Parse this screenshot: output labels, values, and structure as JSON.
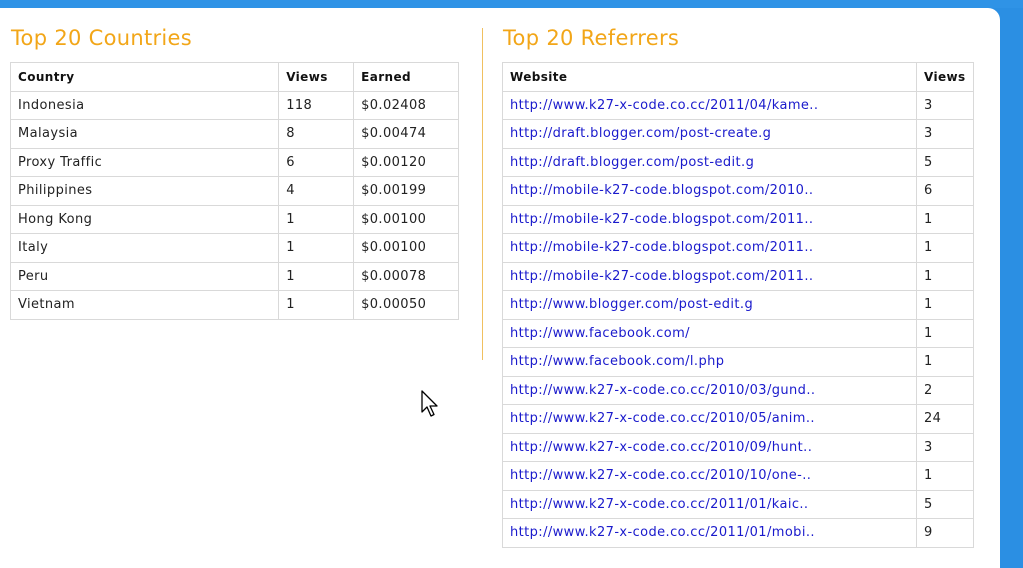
{
  "countries": {
    "title": "Top 20 Countries",
    "headers": {
      "country": "Country",
      "views": "Views",
      "earned": "Earned"
    },
    "rows": [
      {
        "country": "Indonesia",
        "views": "118",
        "earned": "$0.02408"
      },
      {
        "country": "Malaysia",
        "views": "8",
        "earned": "$0.00474"
      },
      {
        "country": "Proxy Traffic",
        "views": "6",
        "earned": "$0.00120"
      },
      {
        "country": "Philippines",
        "views": "4",
        "earned": "$0.00199"
      },
      {
        "country": "Hong Kong",
        "views": "1",
        "earned": "$0.00100"
      },
      {
        "country": "Italy",
        "views": "1",
        "earned": "$0.00100"
      },
      {
        "country": "Peru",
        "views": "1",
        "earned": "$0.00078"
      },
      {
        "country": "Vietnam",
        "views": "1",
        "earned": "$0.00050"
      }
    ]
  },
  "referrers": {
    "title": "Top 20 Referrers",
    "headers": {
      "website": "Website",
      "views": "Views"
    },
    "rows": [
      {
        "website": "http://www.k27-x-code.co.cc/2011/04/kame..",
        "views": "3"
      },
      {
        "website": "http://draft.blogger.com/post-create.g",
        "views": "3"
      },
      {
        "website": "http://draft.blogger.com/post-edit.g",
        "views": "5"
      },
      {
        "website": "http://mobile-k27-code.blogspot.com/2010..",
        "views": "6"
      },
      {
        "website": "http://mobile-k27-code.blogspot.com/2011..",
        "views": "1"
      },
      {
        "website": "http://mobile-k27-code.blogspot.com/2011..",
        "views": "1"
      },
      {
        "website": "http://mobile-k27-code.blogspot.com/2011..",
        "views": "1"
      },
      {
        "website": "http://www.blogger.com/post-edit.g",
        "views": "1"
      },
      {
        "website": "http://www.facebook.com/",
        "views": "1"
      },
      {
        "website": "http://www.facebook.com/l.php",
        "views": "1"
      },
      {
        "website": "http://www.k27-x-code.co.cc/2010/03/gund..",
        "views": "2"
      },
      {
        "website": "http://www.k27-x-code.co.cc/2010/05/anim..",
        "views": "24"
      },
      {
        "website": "http://www.k27-x-code.co.cc/2010/09/hunt..",
        "views": "3"
      },
      {
        "website": "http://www.k27-x-code.co.cc/2010/10/one-..",
        "views": "1"
      },
      {
        "website": "http://www.k27-x-code.co.cc/2011/01/kaic..",
        "views": "5"
      },
      {
        "website": "http://www.k27-x-code.co.cc/2011/01/mobi..",
        "views": "9"
      }
    ]
  },
  "colors": {
    "title": "#f2a618",
    "link": "#1a1acc",
    "frame": "#2b8fe3"
  },
  "cursor_icon": "arrow-pointer"
}
